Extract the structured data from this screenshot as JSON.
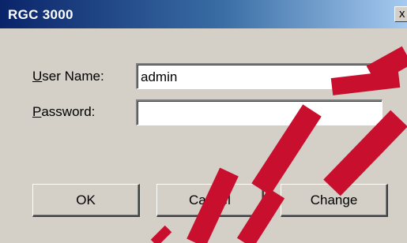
{
  "window": {
    "title": "RGC 3000",
    "close_glyph": "x"
  },
  "form": {
    "username_label_accel": "U",
    "username_label_rest": "ser Name:",
    "username_value": "admin",
    "password_label_accel": "P",
    "password_label_rest": "assword:",
    "password_value": ""
  },
  "buttons": {
    "ok_label": "OK",
    "cancel_label": "Cancel",
    "change_label": "Change"
  },
  "colors": {
    "titlebar_start": "#0a246a",
    "titlebar_end": "#a6caf0",
    "dialog_face": "#d4d0c8",
    "watermark": "#c8102e"
  }
}
